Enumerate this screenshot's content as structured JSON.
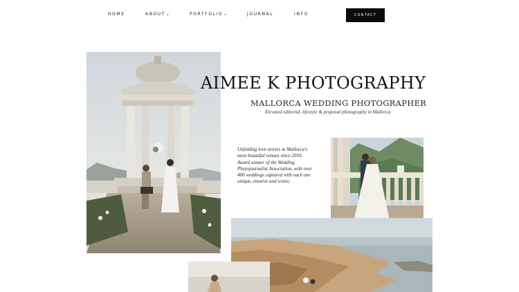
{
  "nav": {
    "items": [
      {
        "label": "HOME",
        "has_dropdown": false
      },
      {
        "label": "ABOUT",
        "has_dropdown": true
      },
      {
        "label": "PORTFOLIO",
        "has_dropdown": true
      },
      {
        "label": "JOURNAL",
        "has_dropdown": false
      },
      {
        "label": "INFO",
        "has_dropdown": false
      }
    ],
    "dropdown_icon": "chevron-down-icon",
    "contact_label": "CONTACT"
  },
  "hero": {
    "title": "AIMEE K PHOTOGRAPHY",
    "subtitle": "MALLORCA WEDDING PHOTOGRAPHER",
    "tagline": "Elevated editorial, lifestyle & proposal photography in Mallorca",
    "intro": "Unfolding love stories in Mallorca's most beautiful venues since 2010. Award winner of the Wedding Photojournalist Association, with over 400 weddings captured with each one unique, emotive and iconic."
  },
  "colors": {
    "background": "#ffffff",
    "text": "#111111",
    "button_bg": "#0b0b0b",
    "button_text": "#ffffff"
  }
}
